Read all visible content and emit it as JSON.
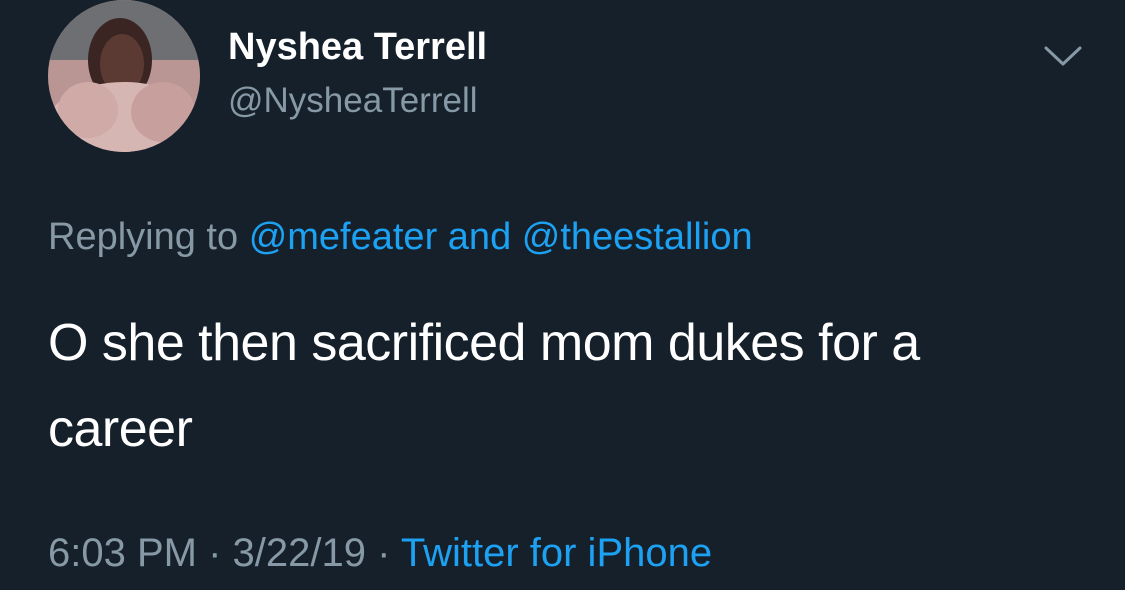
{
  "tweet": {
    "author": {
      "display_name": "Nyshea Terrell",
      "handle": "@NysheaTerrell",
      "avatar_icon": "profile-photo"
    },
    "menu_icon": "chevron-down-icon",
    "replying": {
      "prefix": "Replying to",
      "mention_1": "@mefeater",
      "conjunction": "and",
      "mention_2": "@theestallion"
    },
    "text_line_1": "O she then sacrificed mom dukes for a",
    "text_line_2": "career",
    "time": "6:03 PM",
    "separator": "·",
    "date": "3/22/19",
    "source": "Twitter for iPhone"
  },
  "colors": {
    "background": "#15202b",
    "primary_text": "#ffffff",
    "secondary_text": "#8899a6",
    "link": "#1da1f2"
  }
}
